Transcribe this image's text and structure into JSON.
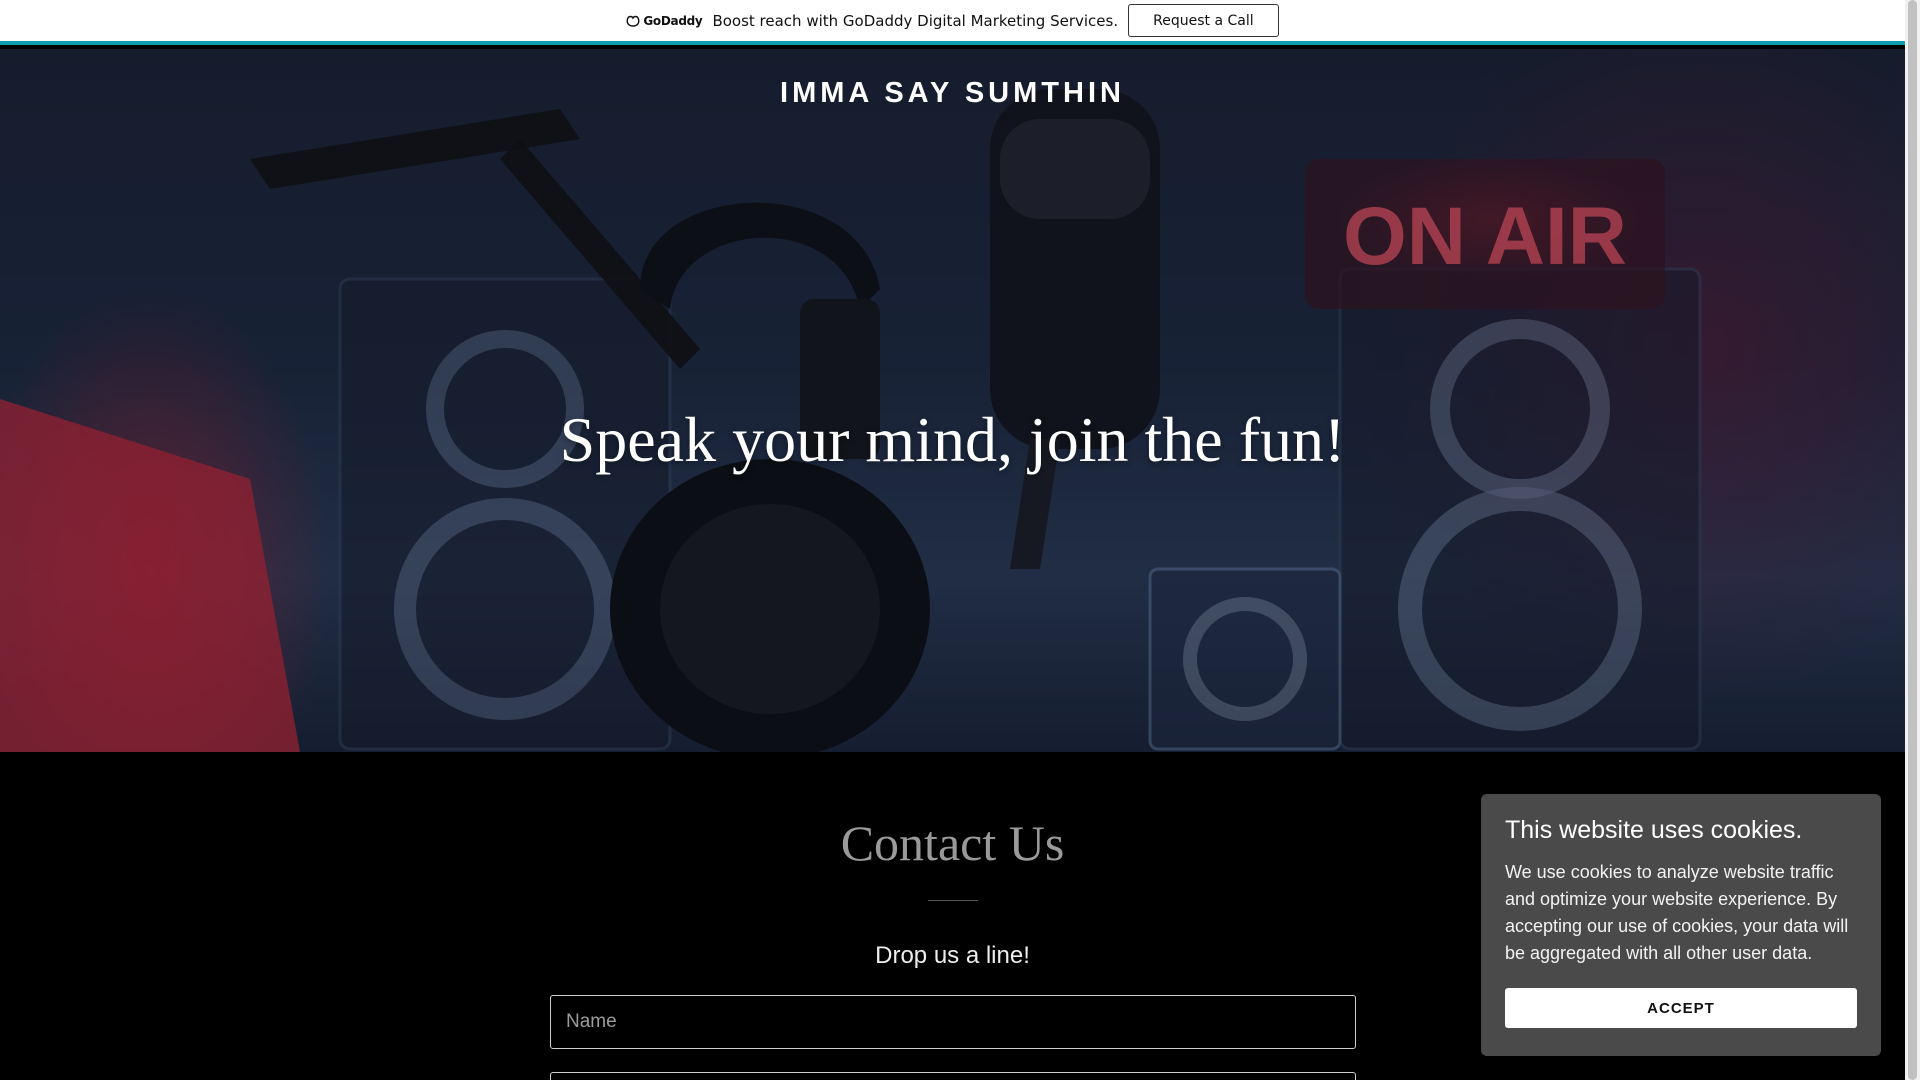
{
  "promo": {
    "logo_text": "GoDaddy",
    "text": "Boost reach with GoDaddy Digital Marketing Services.",
    "button_label": "Request a Call"
  },
  "hero": {
    "site_title": "IMMA SAY SUMTHIN",
    "tagline": "Speak your mind, join the fun!",
    "sign_text": "ON AIR"
  },
  "contact": {
    "title": "Contact Us",
    "subtitle": "Drop us a line!",
    "name_placeholder": "Name",
    "email_placeholder": ""
  },
  "cookie": {
    "title": "This website uses cookies.",
    "body": "We use cookies to analyze website traffic and optimize your website experience. By accepting our use of cookies, your data will be aggregated with all other user data.",
    "accept_label": "ACCEPT"
  },
  "colors": {
    "promo_border": "#0e9db0",
    "contact_bg": "#000000",
    "cookie_bg": "#4a4a4a",
    "accent_red": "#d8283a"
  }
}
